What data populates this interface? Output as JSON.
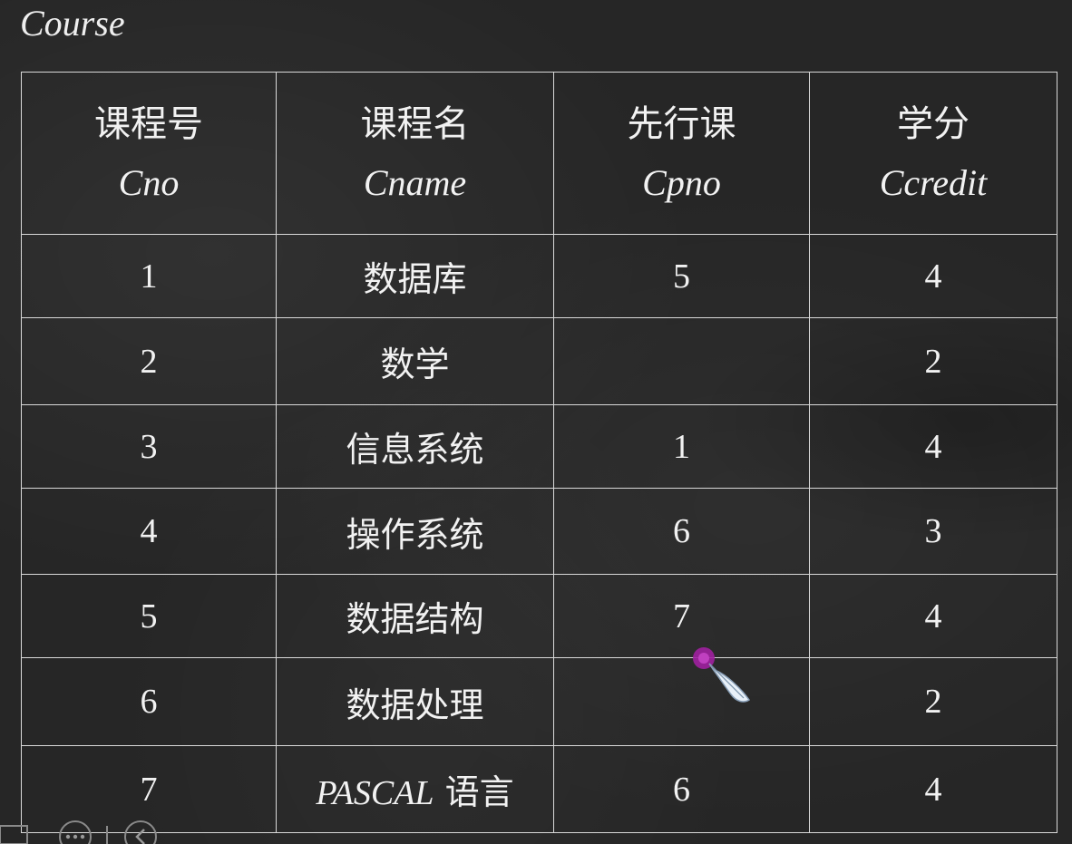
{
  "title": "Course",
  "table": {
    "headers": [
      {
        "cn": "课程号",
        "en": "Cno"
      },
      {
        "cn": "课程名",
        "en": "Cname"
      },
      {
        "cn": "先行课",
        "en": "Cpno"
      },
      {
        "cn": "学分",
        "en": "Ccredit"
      }
    ],
    "rows": [
      {
        "cno": "1",
        "cname": "数据库",
        "cpno": "5",
        "ccredit": "4"
      },
      {
        "cno": "2",
        "cname": "数学",
        "cpno": "",
        "ccredit": "2"
      },
      {
        "cno": "3",
        "cname": "信息系统",
        "cpno": "1",
        "ccredit": "4"
      },
      {
        "cno": "4",
        "cname": "操作系统",
        "cpno": "6",
        "ccredit": "3"
      },
      {
        "cno": "5",
        "cname": "数据结构",
        "cpno": "7",
        "ccredit": "4"
      },
      {
        "cno": "6",
        "cname": "数据处理",
        "cpno": "",
        "ccredit": "2"
      },
      {
        "cno": "7",
        "cname_latin": "PASCAL",
        "cname": "语言",
        "cpno": "6",
        "ccredit": "4"
      }
    ]
  },
  "pointer_icon": "feather-pen-icon",
  "controls": [
    "more-icon",
    "back-icon"
  ],
  "colors": {
    "background": "#262626",
    "text": "#f2f2f2",
    "grid": "#d9d9d9",
    "pointer_dot": "#a020a0"
  }
}
